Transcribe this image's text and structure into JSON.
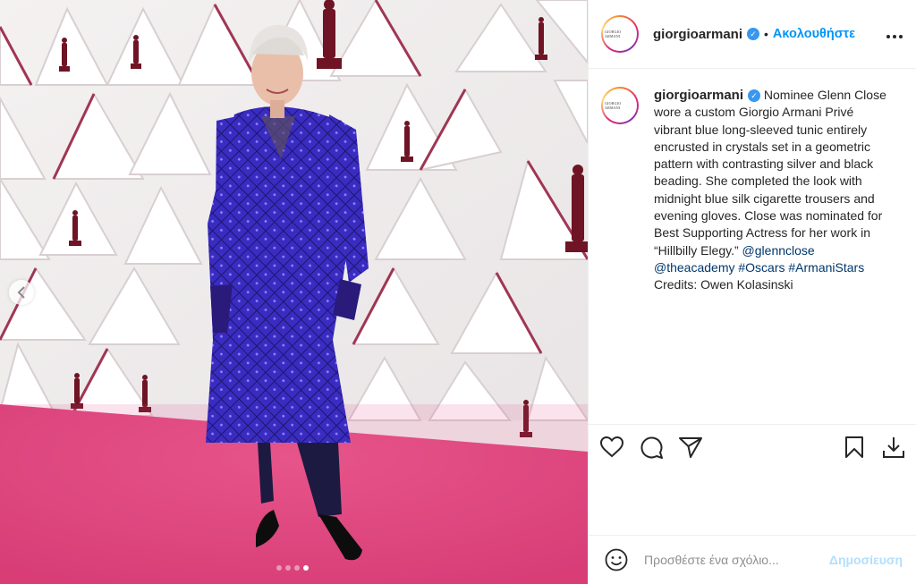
{
  "post": {
    "username": "giorgioarmani",
    "avatar_text": "GIORGIO ARMANI",
    "follow_label": "Ακολουθήστε",
    "separator": "•",
    "more_icon": "more-horizontal-icon",
    "caption": {
      "text": "Nominee Glenn Close wore a custom Giorgio Armani Privé vibrant blue long-sleeved tunic entirely encrusted in crystals set in a geometric pattern with contrasting silver and black beading. She completed the look with midnight blue silk cigarette trousers and evening gloves. Close was nominated for Best Supporting Actress for her work in “Hillbilly Elegy.”",
      "tags": [
        "@glennclose",
        "@theacademy",
        "#Oscars",
        "#ArmaniStars"
      ],
      "credits": "Credits: Owen Kolasinski"
    }
  },
  "carousel": {
    "slide_count": 4,
    "active_index": 3
  },
  "actions": {
    "like": "heart-icon",
    "comment": "comment-icon",
    "share": "send-icon",
    "save": "bookmark-icon",
    "download": "download-icon"
  },
  "comment_bar": {
    "placeholder": "Προσθέστε ένα σχόλιο...",
    "publish_label": "Δημοσίευση",
    "emoji_icon": "smiley-icon"
  },
  "colors": {
    "link": "#00376b",
    "follow": "#0095f6",
    "verified": "#3897f0",
    "carpet": "#e0457f",
    "dress": "#3d2bc4"
  }
}
